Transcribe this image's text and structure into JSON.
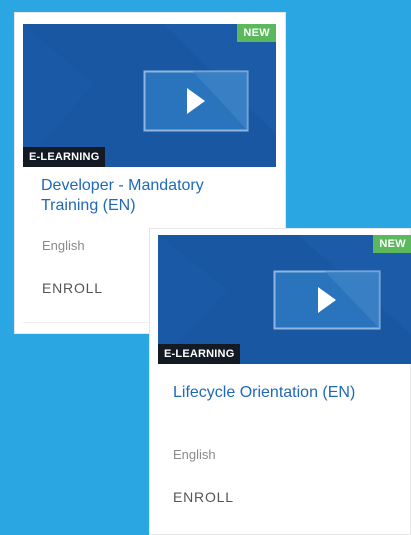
{
  "courses": [
    {
      "badge": "NEW",
      "type": "E-LEARNING",
      "title": "Developer - Mandatory Training (EN)",
      "language": "English",
      "action": "ENROLL"
    },
    {
      "badge": "NEW",
      "type": "E-LEARNING",
      "title": "Lifecycle Orientation (EN)",
      "language": "English",
      "action": "ENROLL"
    }
  ],
  "colors": {
    "page_background": "#2aa7e2",
    "thumbnail": "#1957a3",
    "new_badge": "#5cb85c",
    "type_badge": "#141a24",
    "title": "#1f69b7"
  },
  "icons": [
    "play-icon"
  ]
}
